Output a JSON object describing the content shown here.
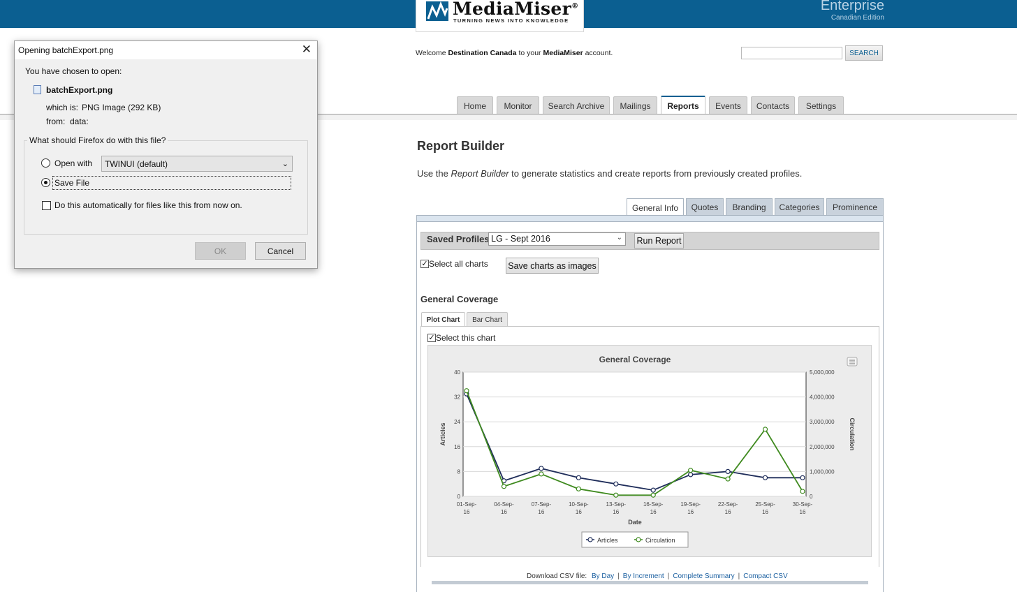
{
  "header": {
    "logo_name": "MediaMiser",
    "logo_reg": "®",
    "logo_tagline": "TURNING NEWS INTO KNOWLEDGE",
    "edition_name": "Enterprise",
    "edition_sub": "Canadian Edition",
    "brand_color": "#0b5f91",
    "welcome_prefix": "Welcome",
    "welcome_user": "Destination Canada",
    "welcome_mid": "to your",
    "welcome_brand": "MediaMiser",
    "welcome_suffix": "account.",
    "search_value": "",
    "search_button": "SEARCH"
  },
  "nav": {
    "tabs": [
      "Home",
      "Monitor",
      "Search Archive",
      "Mailings",
      "Reports",
      "Events",
      "Contacts",
      "Settings"
    ],
    "active": "Reports"
  },
  "main": {
    "title": "Report Builder",
    "desc_prefix": "Use the",
    "desc_em": "Report Builder",
    "desc_suffix": "to generate statistics and create reports from previously created profiles.",
    "subtabs": [
      "General Info",
      "Quotes",
      "Branding",
      "Categories",
      "Prominence"
    ],
    "active_subtab": "General Info",
    "saved_profiles_label": "Saved Profiles:",
    "saved_profile_value": "LG - Sept 2016",
    "run_report_button": "Run Report",
    "select_all_label": "Select all charts",
    "select_all_checked": true,
    "save_images_button": "Save charts as images",
    "section_title": "General Coverage",
    "chart_tabs": [
      "Plot Chart",
      "Bar Chart"
    ],
    "active_chart_tab": "Plot Chart",
    "select_chart_label": "Select this chart",
    "select_chart_checked": true,
    "download_label": "Download CSV file:",
    "download_links": [
      "By Day",
      "By Increment",
      "Complete Summary",
      "Compact CSV"
    ]
  },
  "chart_data": {
    "type": "line",
    "title": "General Coverage",
    "xlabel": "Date",
    "ylabel": "Articles",
    "y2label": "Circulation",
    "x": [
      "01-Sep-16",
      "04-Sep-16",
      "07-Sep-16",
      "10-Sep-16",
      "13-Sep-16",
      "16-Sep-16",
      "19-Sep-16",
      "22-Sep-16",
      "25-Sep-16",
      "30-Sep-16"
    ],
    "ylim": [
      0,
      40
    ],
    "yticks": [
      "0",
      "8",
      "16",
      "24",
      "32",
      "40"
    ],
    "y2lim": [
      0,
      5000000
    ],
    "y2ticks": [
      "0",
      "1,000,000",
      "2,000,000",
      "3,000,000",
      "4,000,000",
      "5,000,000"
    ],
    "grid": true,
    "legend_position": "bottom",
    "series": [
      {
        "name": "Articles",
        "axis": "left",
        "color": "#1f2d5a",
        "values": [
          33,
          5,
          9,
          6,
          4,
          2,
          7,
          8,
          6,
          6
        ]
      },
      {
        "name": "Circulation",
        "axis": "right",
        "color": "#3f8a1f",
        "values": [
          4250000,
          400000,
          900000,
          300000,
          50000,
          50000,
          1050000,
          700000,
          2700000,
          200000
        ]
      }
    ]
  },
  "dialog": {
    "title": "Opening batchExport.png",
    "chosen_label": "You have chosen to open:",
    "filename": "batchExport.png",
    "which_is_label": "which is:",
    "which_is_value": "PNG Image (292 KB)",
    "from_label": "from:",
    "from_value": "data:",
    "question": "What should Firefox do with this file?",
    "open_with_label": "Open with",
    "open_with_value": "TWINUI (default)",
    "save_file_label": "Save File",
    "selected_option": "Save File",
    "auto_label": "Do this automatically for files like this from now on.",
    "auto_checked": false,
    "ok_button": "OK",
    "cancel_button": "Cancel"
  }
}
